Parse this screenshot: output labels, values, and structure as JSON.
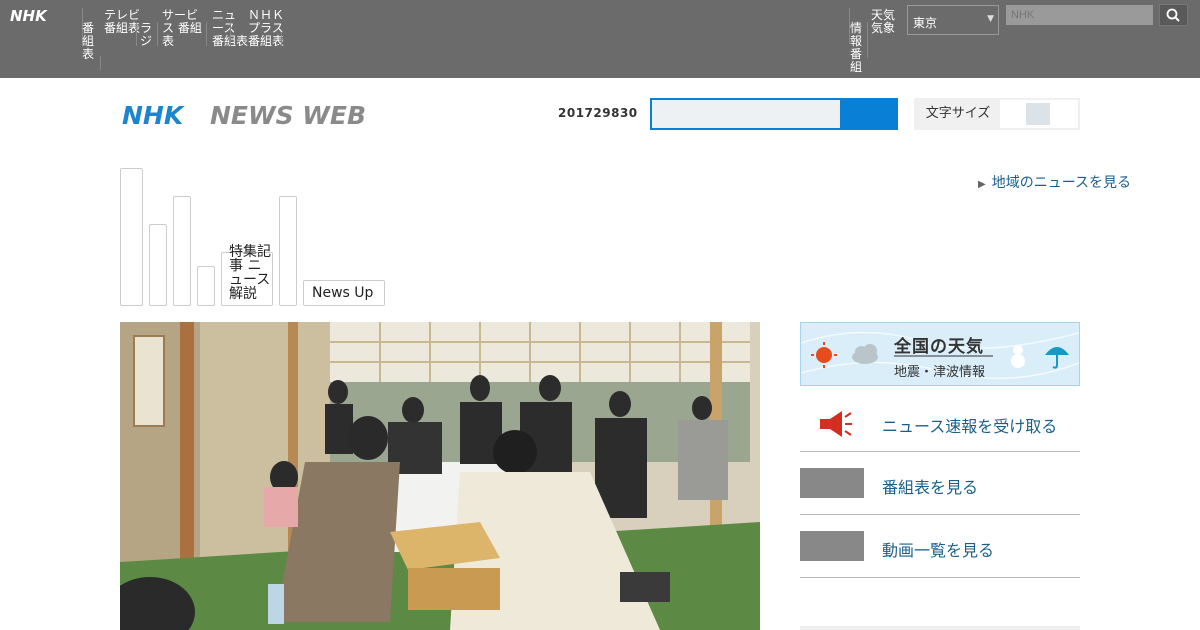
{
  "topbar": {
    "logo": "NHK",
    "nav_items": [
      "番組表",
      "テレビ 番組表",
      "ラジ",
      "サービス 番組表",
      "ニュース 番組表",
      "ＮＨＫ プラス番組表"
    ],
    "right_items": [
      "情報 番組",
      "天気 気象"
    ],
    "region_value": "東京",
    "search_placeholder": "NHK"
  },
  "newsweb": {
    "logo_nhk": "NHK",
    "logo_text": "NEWS WEB",
    "counter": "201729830",
    "search_placeholder": "",
    "setting_label": "文字サイズ",
    "region_link": "地域のニュースを見る"
  },
  "tabs": [
    {
      "label": ""
    },
    {
      "label": ""
    },
    {
      "label": ""
    },
    {
      "label": ""
    },
    {
      "label": "特集記事 ニュース 解説"
    },
    {
      "label": ""
    },
    {
      "label": "News Up"
    }
  ],
  "sidebar": {
    "weather_title": "全国の天気",
    "weather_sub": "地震・津波情報",
    "rows": [
      "ニュース速報を受け取る",
      "番組表を見る",
      "動画一覧を見る"
    ]
  },
  "colors": {
    "accent": "#0a7fd6",
    "topbar": "#6b6b6b",
    "link": "#1a5f8a"
  }
}
